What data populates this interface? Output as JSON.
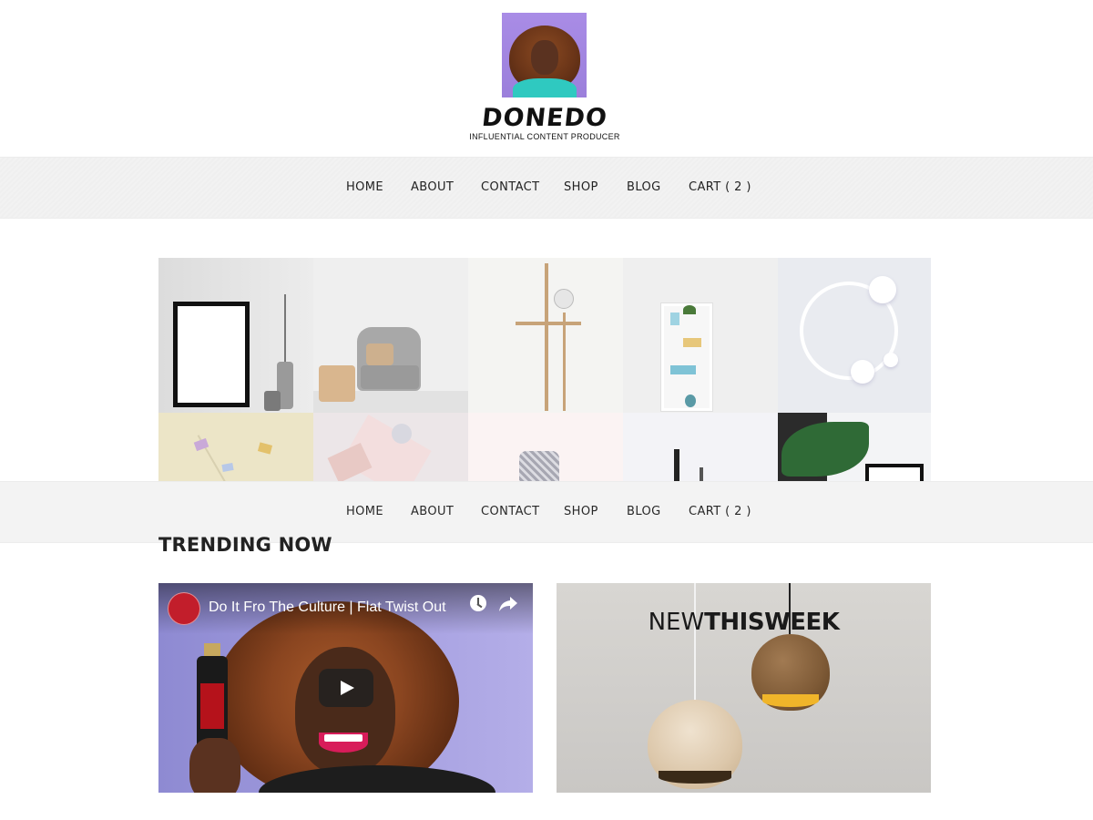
{
  "brand": {
    "name": "DONEDO",
    "tagline": "INFLUENTIAL CONTENT PRODUCER"
  },
  "nav": {
    "items": [
      {
        "label": "HOME"
      },
      {
        "label": "ABOUT"
      },
      {
        "label": "CONTACT"
      },
      {
        "label": "SHOP"
      },
      {
        "label": "BLOG"
      },
      {
        "label": "CART ( 2 )"
      }
    ]
  },
  "sticky_nav": {
    "items": [
      {
        "label": "HOME"
      },
      {
        "label": "ABOUT"
      },
      {
        "label": "CONTACT"
      },
      {
        "label": "SHOP"
      },
      {
        "label": "BLOG"
      },
      {
        "label": "CART ( 2 )"
      }
    ]
  },
  "trending": {
    "title": "TRENDING NOW"
  },
  "video": {
    "title": "Do It Fro The Culture | Flat Twist Out",
    "icons": [
      "clock-icon",
      "share-icon",
      "play-icon"
    ]
  },
  "promo": {
    "headline_light": "NEW",
    "headline_bold": "THISWEEK"
  },
  "colors": {
    "nav_background": "#f2f2f2",
    "logo_background": "#a98ce6",
    "text": "#222222"
  }
}
